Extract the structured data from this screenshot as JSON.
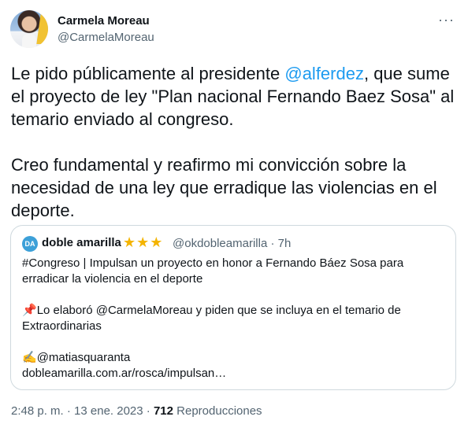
{
  "author": {
    "name": "Carmela Moreau",
    "handle": "@CarmelaMoreau",
    "more_icon": "more-horizontal-icon"
  },
  "tweet": {
    "part1": "Le pido públicamente al presidente ",
    "mention": "@alferdez",
    "part2": ", que sume el proyecto de ley \"Plan nacional Fernando Baez Sosa\" al temario enviado al congreso.\n\nCreo fundamental y reafirmo mi convicción sobre la necesidad de una ley que erradique las violencias en el deporte."
  },
  "quote": {
    "avatar_text": "DA",
    "name": "doble amarilla",
    "stars": "★★★",
    "meta": "@okdobleamarilla · 7h",
    "line1": "#Congreso | Impulsan un proyecto en honor a Fernando Báez Sosa para erradicar la violencia en el deporte",
    "pin_icon": "📌",
    "line2": "Lo elaboró @CarmelaMoreau y piden que se incluya en el temario de Extraordinarias",
    "pen_icon": "✍️",
    "line3": "@matiasquaranta",
    "link": "dobleamarilla.com.ar/rosca/impulsan…"
  },
  "footer": {
    "time": "2:48 p. m. · 13 ene. 2023 · ",
    "views_count": "712",
    "views_label": " Reproducciones"
  }
}
